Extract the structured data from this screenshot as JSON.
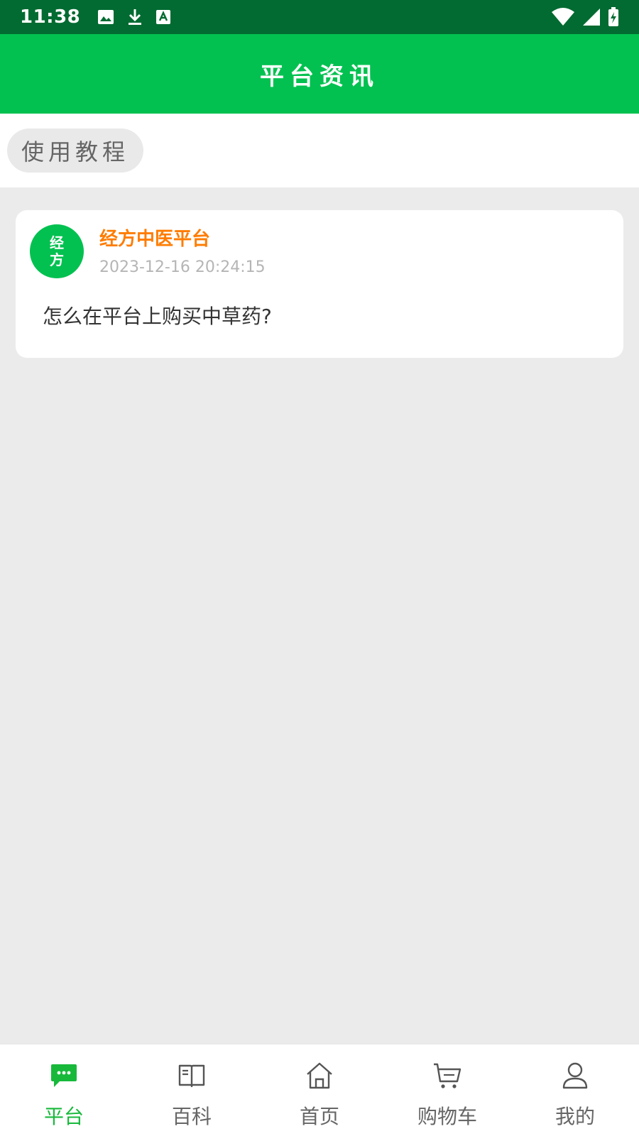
{
  "status_bar": {
    "time": "11:38",
    "left_icons": [
      "image-icon",
      "download-icon",
      "keyboard-a-icon"
    ],
    "right_icons": [
      "wifi-icon",
      "signal-icon",
      "battery-charging-icon"
    ]
  },
  "header": {
    "title": "平台资讯"
  },
  "categories": [
    {
      "label": "使用教程"
    }
  ],
  "posts": [
    {
      "avatar_line1": "经",
      "avatar_line2": "方",
      "author": "经方中医平台",
      "time": "2023-12-16 20:24:15",
      "title": "怎么在平台上购买中草药?"
    }
  ],
  "tabs": [
    {
      "label": "平台",
      "icon": "chat-bubble-icon",
      "active": true
    },
    {
      "label": "百科",
      "icon": "book-icon",
      "active": false
    },
    {
      "label": "首页",
      "icon": "home-icon",
      "active": false
    },
    {
      "label": "购物车",
      "icon": "cart-icon",
      "active": false
    },
    {
      "label": "我的",
      "icon": "user-icon",
      "active": false
    }
  ],
  "colors": {
    "status_bar": "#016b31",
    "header": "#02c150",
    "accent_green": "#18b93b",
    "author_orange": "#ff7c00",
    "background": "#ebebeb"
  }
}
